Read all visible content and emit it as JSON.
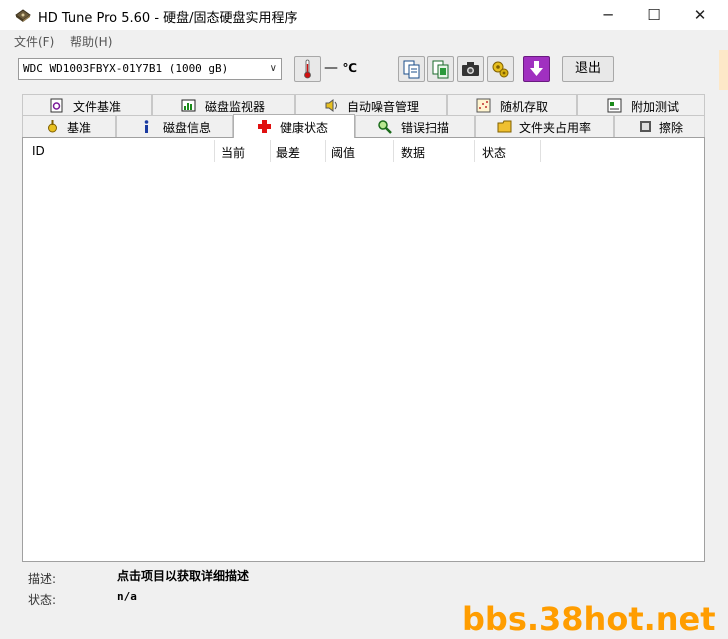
{
  "window": {
    "title": "HD Tune Pro 5.60 - 硬盘/固态硬盘实用程序",
    "minimize": "─",
    "maximize": "☐",
    "close": "✕"
  },
  "menu": [
    "文件(F)",
    "帮助(H)"
  ],
  "toolbar": {
    "drive": "WDC WD1003FBYX-01Y7B1 (1000 gB)",
    "temperature": "— ",
    "temperature_unit": "℃",
    "exit_label": "退出"
  },
  "tabs_row1": [
    {
      "label": "文件基准",
      "icon": "file-benchmark-icon"
    },
    {
      "label": "磁盘监视器",
      "icon": "disk-monitor-icon"
    },
    {
      "label": "自动噪音管理",
      "icon": "speaker-icon"
    },
    {
      "label": "随机存取",
      "icon": "random-access-icon"
    },
    {
      "label": "附加测试",
      "icon": "extra-tests-icon"
    }
  ],
  "tabs_row2": [
    {
      "label": "基准",
      "icon": "benchmark-icon"
    },
    {
      "label": "磁盘信息",
      "icon": "info-icon"
    },
    {
      "label": "健康状态",
      "icon": "health-cross-icon",
      "active": true
    },
    {
      "label": "错误扫描",
      "icon": "magnifier-icon"
    },
    {
      "label": "文件夹占用率",
      "icon": "folder-icon"
    },
    {
      "label": "擦除",
      "icon": "erase-icon"
    }
  ],
  "table": {
    "columns": [
      "ID",
      "当前",
      "最差",
      "阈值",
      "数据",
      "状态"
    ],
    "rows": []
  },
  "footer": {
    "desc_label": "描述:",
    "desc_value": "点击项目以获取详细描述",
    "status_label": "状态:",
    "status_value": "n/a"
  },
  "watermark": "bbs.38hot.net",
  "colors": {
    "accent_active_tab": "#ffffff",
    "watermark": "#ff9d00",
    "health_cross": "#e01010",
    "download_button": "#a030c0"
  }
}
